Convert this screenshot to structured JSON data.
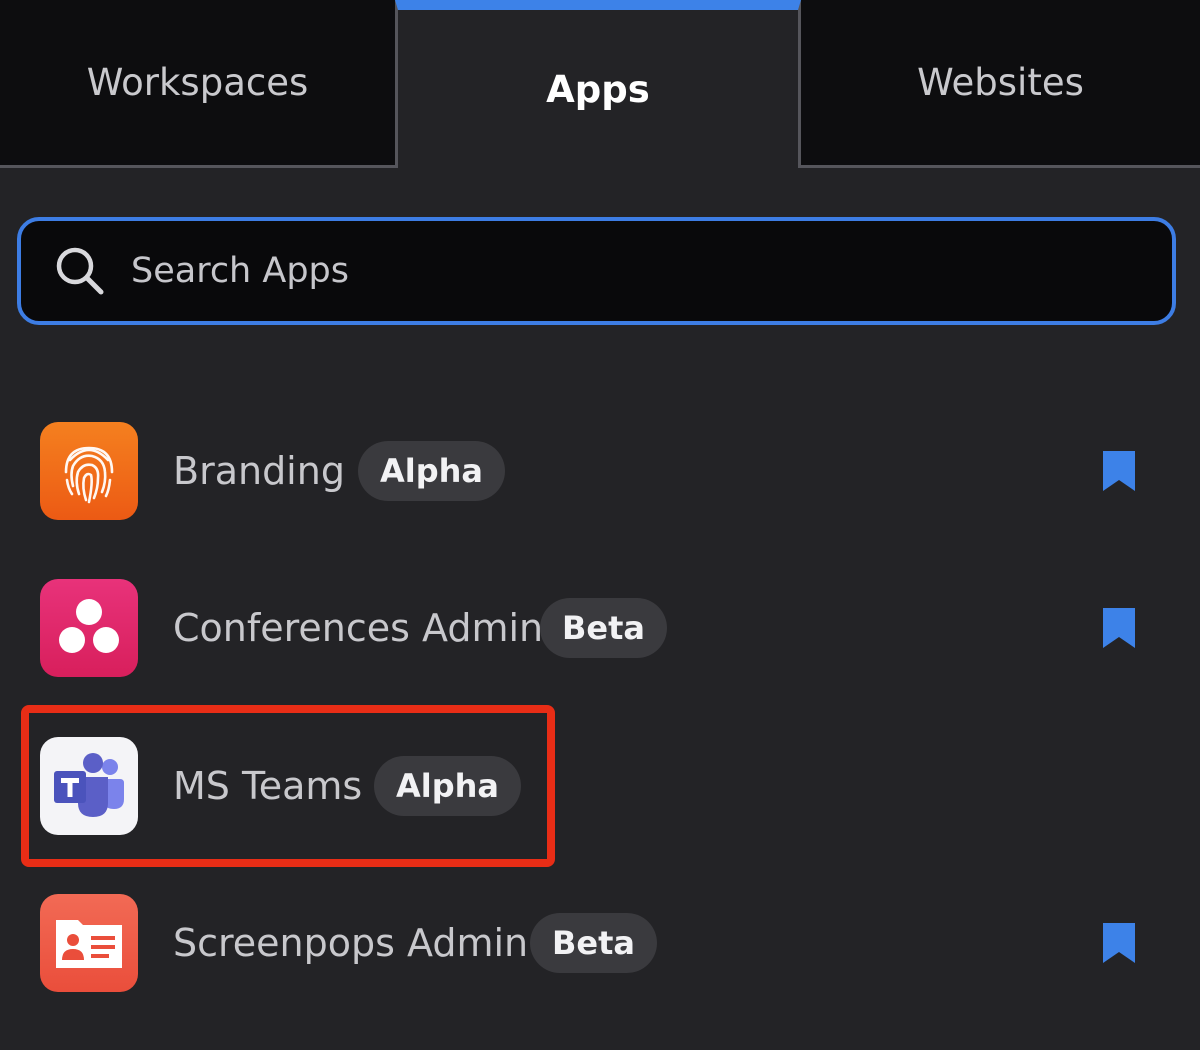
{
  "tabs": [
    {
      "label": "Workspaces",
      "active": false
    },
    {
      "label": "Apps",
      "active": true
    },
    {
      "label": "Websites",
      "active": false
    }
  ],
  "search": {
    "placeholder": "Search Apps",
    "value": ""
  },
  "apps": [
    {
      "name": "Branding",
      "badge": "Alpha",
      "icon": "fingerprint-icon",
      "icon_color": "#f26a1b",
      "bookmarked": true
    },
    {
      "name": "Conferences Admin",
      "badge": "Beta",
      "icon": "conference-icon",
      "icon_color": "#e0286a",
      "bookmarked": true
    },
    {
      "name": "MS Teams",
      "badge": "Alpha",
      "icon": "ms-teams-icon",
      "icon_color": "#5059c9",
      "bookmarked": false,
      "highlighted": true
    },
    {
      "name": "Screenpops Admin",
      "badge": "Beta",
      "icon": "contact-card-icon",
      "icon_color": "#ef5a45",
      "bookmarked": true
    }
  ],
  "colors": {
    "background": "#232326",
    "accent": "#3d82e8",
    "bookmark": "#3d82e8",
    "highlight": "#e82d16"
  }
}
